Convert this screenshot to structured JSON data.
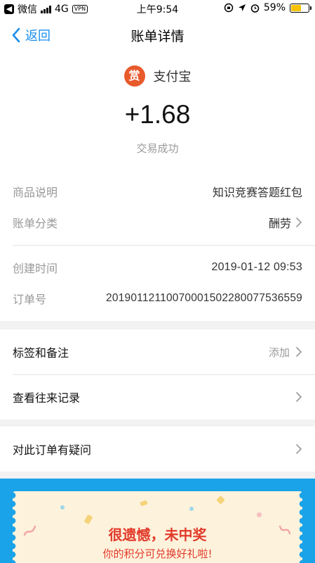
{
  "status_bar": {
    "carrier": "微信",
    "network": "4G",
    "vpn": "VPN",
    "time": "上午9:54",
    "battery": "59%",
    "battery_level": 0.59
  },
  "nav": {
    "back_label": "返回",
    "title": "账单详情"
  },
  "summary": {
    "merchant_logo_text": "赏",
    "merchant_name": "支付宝",
    "amount": "+1.68",
    "status": "交易成功"
  },
  "details": {
    "product_label": "商品说明",
    "product_value": "知识竞赛答题红包",
    "category_label": "账单分类",
    "category_value": "酬劳",
    "created_label": "创建时间",
    "created_value": "2019-01-12 09:53",
    "order_label": "订单号",
    "order_value": "20190112110070001502280077536559"
  },
  "actions": {
    "tags_label": "标签和备注",
    "tags_action": "添加",
    "history_label": "查看往来记录",
    "question_label": "对此订单有疑问"
  },
  "promo": {
    "title": "很遗憾，未中奖",
    "subtitle": "你的积分可兑换好礼啦!"
  },
  "colors": {
    "accent": "#1a8ff0",
    "promo_bg": "#1aa3e8",
    "promo_text": "#e23a2a",
    "logo_bg": "#e85a2c"
  }
}
